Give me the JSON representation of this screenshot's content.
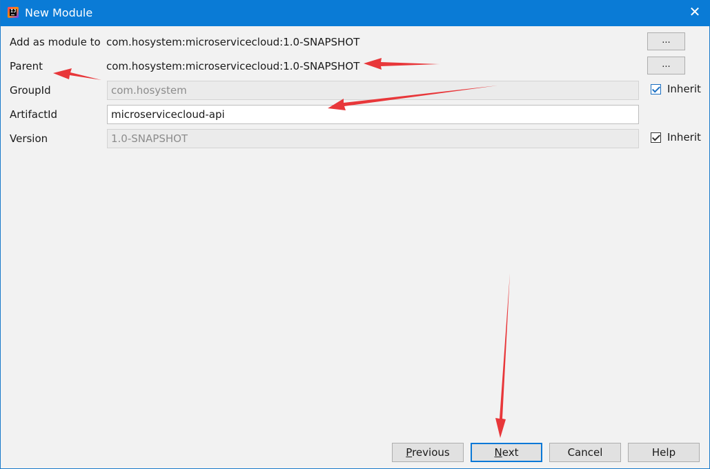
{
  "window": {
    "title": "New Module"
  },
  "form": {
    "add_as_module_to": {
      "label": "Add as module to",
      "value": "com.hosystem:microservicecloud:1.0-SNAPSHOT",
      "browse_label": "..."
    },
    "parent": {
      "label": "Parent",
      "value": "com.hosystem:microservicecloud:1.0-SNAPSHOT",
      "browse_label": "..."
    },
    "group_id": {
      "label": "GroupId",
      "value": "com.hosystem",
      "inherit_label": "Inherit",
      "inherit_checked": true
    },
    "artifact_id": {
      "label": "ArtifactId",
      "value": "microservicecloud-api"
    },
    "version": {
      "label": "Version",
      "value": "1.0-SNAPSHOT",
      "inherit_label": "Inherit",
      "inherit_checked": true
    }
  },
  "buttons": {
    "previous_mnemonic": "P",
    "previous_rest": "revious",
    "next_mnemonic": "N",
    "next_rest": "ext",
    "cancel": "Cancel",
    "help": "Help"
  },
  "colors": {
    "titlebar": "#0a7bd6",
    "annotation_arrow": "#e8373a",
    "default_button_border": "#0a78d7"
  },
  "icons": {
    "app": "intellij-idea-icon",
    "close": "close-icon",
    "annotation": "red-arrow-icon"
  }
}
